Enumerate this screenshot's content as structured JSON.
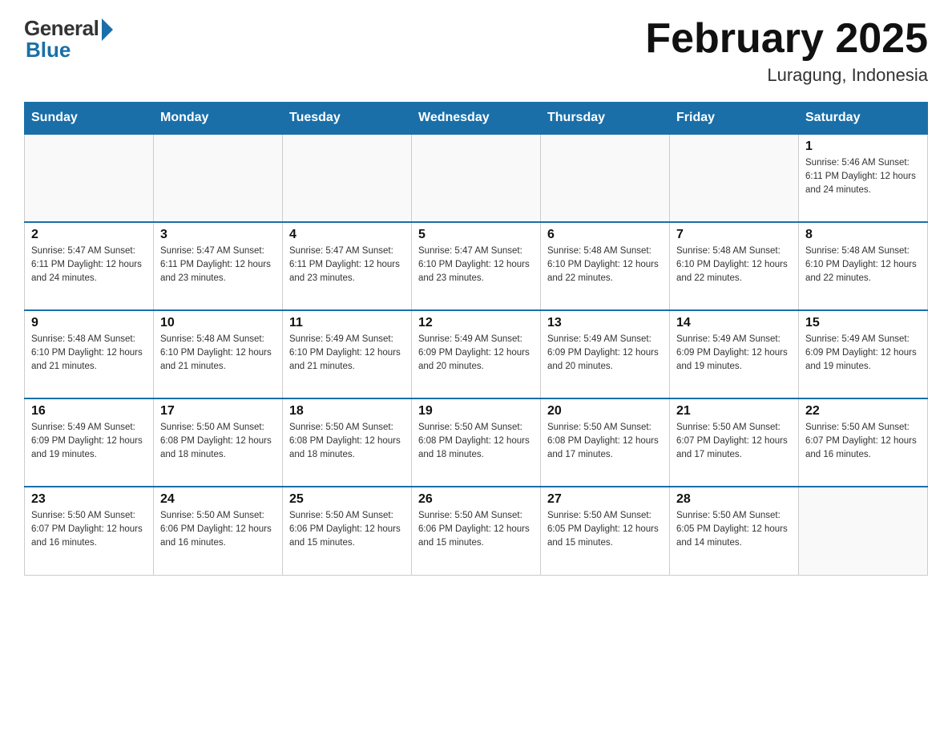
{
  "header": {
    "logo_general": "General",
    "logo_blue": "Blue",
    "month_year": "February 2025",
    "location": "Luragung, Indonesia"
  },
  "weekdays": [
    "Sunday",
    "Monday",
    "Tuesday",
    "Wednesday",
    "Thursday",
    "Friday",
    "Saturday"
  ],
  "weeks": [
    [
      {
        "day": "",
        "info": ""
      },
      {
        "day": "",
        "info": ""
      },
      {
        "day": "",
        "info": ""
      },
      {
        "day": "",
        "info": ""
      },
      {
        "day": "",
        "info": ""
      },
      {
        "day": "",
        "info": ""
      },
      {
        "day": "1",
        "info": "Sunrise: 5:46 AM\nSunset: 6:11 PM\nDaylight: 12 hours\nand 24 minutes."
      }
    ],
    [
      {
        "day": "2",
        "info": "Sunrise: 5:47 AM\nSunset: 6:11 PM\nDaylight: 12 hours\nand 24 minutes."
      },
      {
        "day": "3",
        "info": "Sunrise: 5:47 AM\nSunset: 6:11 PM\nDaylight: 12 hours\nand 23 minutes."
      },
      {
        "day": "4",
        "info": "Sunrise: 5:47 AM\nSunset: 6:11 PM\nDaylight: 12 hours\nand 23 minutes."
      },
      {
        "day": "5",
        "info": "Sunrise: 5:47 AM\nSunset: 6:10 PM\nDaylight: 12 hours\nand 23 minutes."
      },
      {
        "day": "6",
        "info": "Sunrise: 5:48 AM\nSunset: 6:10 PM\nDaylight: 12 hours\nand 22 minutes."
      },
      {
        "day": "7",
        "info": "Sunrise: 5:48 AM\nSunset: 6:10 PM\nDaylight: 12 hours\nand 22 minutes."
      },
      {
        "day": "8",
        "info": "Sunrise: 5:48 AM\nSunset: 6:10 PM\nDaylight: 12 hours\nand 22 minutes."
      }
    ],
    [
      {
        "day": "9",
        "info": "Sunrise: 5:48 AM\nSunset: 6:10 PM\nDaylight: 12 hours\nand 21 minutes."
      },
      {
        "day": "10",
        "info": "Sunrise: 5:48 AM\nSunset: 6:10 PM\nDaylight: 12 hours\nand 21 minutes."
      },
      {
        "day": "11",
        "info": "Sunrise: 5:49 AM\nSunset: 6:10 PM\nDaylight: 12 hours\nand 21 minutes."
      },
      {
        "day": "12",
        "info": "Sunrise: 5:49 AM\nSunset: 6:09 PM\nDaylight: 12 hours\nand 20 minutes."
      },
      {
        "day": "13",
        "info": "Sunrise: 5:49 AM\nSunset: 6:09 PM\nDaylight: 12 hours\nand 20 minutes."
      },
      {
        "day": "14",
        "info": "Sunrise: 5:49 AM\nSunset: 6:09 PM\nDaylight: 12 hours\nand 19 minutes."
      },
      {
        "day": "15",
        "info": "Sunrise: 5:49 AM\nSunset: 6:09 PM\nDaylight: 12 hours\nand 19 minutes."
      }
    ],
    [
      {
        "day": "16",
        "info": "Sunrise: 5:49 AM\nSunset: 6:09 PM\nDaylight: 12 hours\nand 19 minutes."
      },
      {
        "day": "17",
        "info": "Sunrise: 5:50 AM\nSunset: 6:08 PM\nDaylight: 12 hours\nand 18 minutes."
      },
      {
        "day": "18",
        "info": "Sunrise: 5:50 AM\nSunset: 6:08 PM\nDaylight: 12 hours\nand 18 minutes."
      },
      {
        "day": "19",
        "info": "Sunrise: 5:50 AM\nSunset: 6:08 PM\nDaylight: 12 hours\nand 18 minutes."
      },
      {
        "day": "20",
        "info": "Sunrise: 5:50 AM\nSunset: 6:08 PM\nDaylight: 12 hours\nand 17 minutes."
      },
      {
        "day": "21",
        "info": "Sunrise: 5:50 AM\nSunset: 6:07 PM\nDaylight: 12 hours\nand 17 minutes."
      },
      {
        "day": "22",
        "info": "Sunrise: 5:50 AM\nSunset: 6:07 PM\nDaylight: 12 hours\nand 16 minutes."
      }
    ],
    [
      {
        "day": "23",
        "info": "Sunrise: 5:50 AM\nSunset: 6:07 PM\nDaylight: 12 hours\nand 16 minutes."
      },
      {
        "day": "24",
        "info": "Sunrise: 5:50 AM\nSunset: 6:06 PM\nDaylight: 12 hours\nand 16 minutes."
      },
      {
        "day": "25",
        "info": "Sunrise: 5:50 AM\nSunset: 6:06 PM\nDaylight: 12 hours\nand 15 minutes."
      },
      {
        "day": "26",
        "info": "Sunrise: 5:50 AM\nSunset: 6:06 PM\nDaylight: 12 hours\nand 15 minutes."
      },
      {
        "day": "27",
        "info": "Sunrise: 5:50 AM\nSunset: 6:05 PM\nDaylight: 12 hours\nand 15 minutes."
      },
      {
        "day": "28",
        "info": "Sunrise: 5:50 AM\nSunset: 6:05 PM\nDaylight: 12 hours\nand 14 minutes."
      },
      {
        "day": "",
        "info": ""
      }
    ]
  ]
}
